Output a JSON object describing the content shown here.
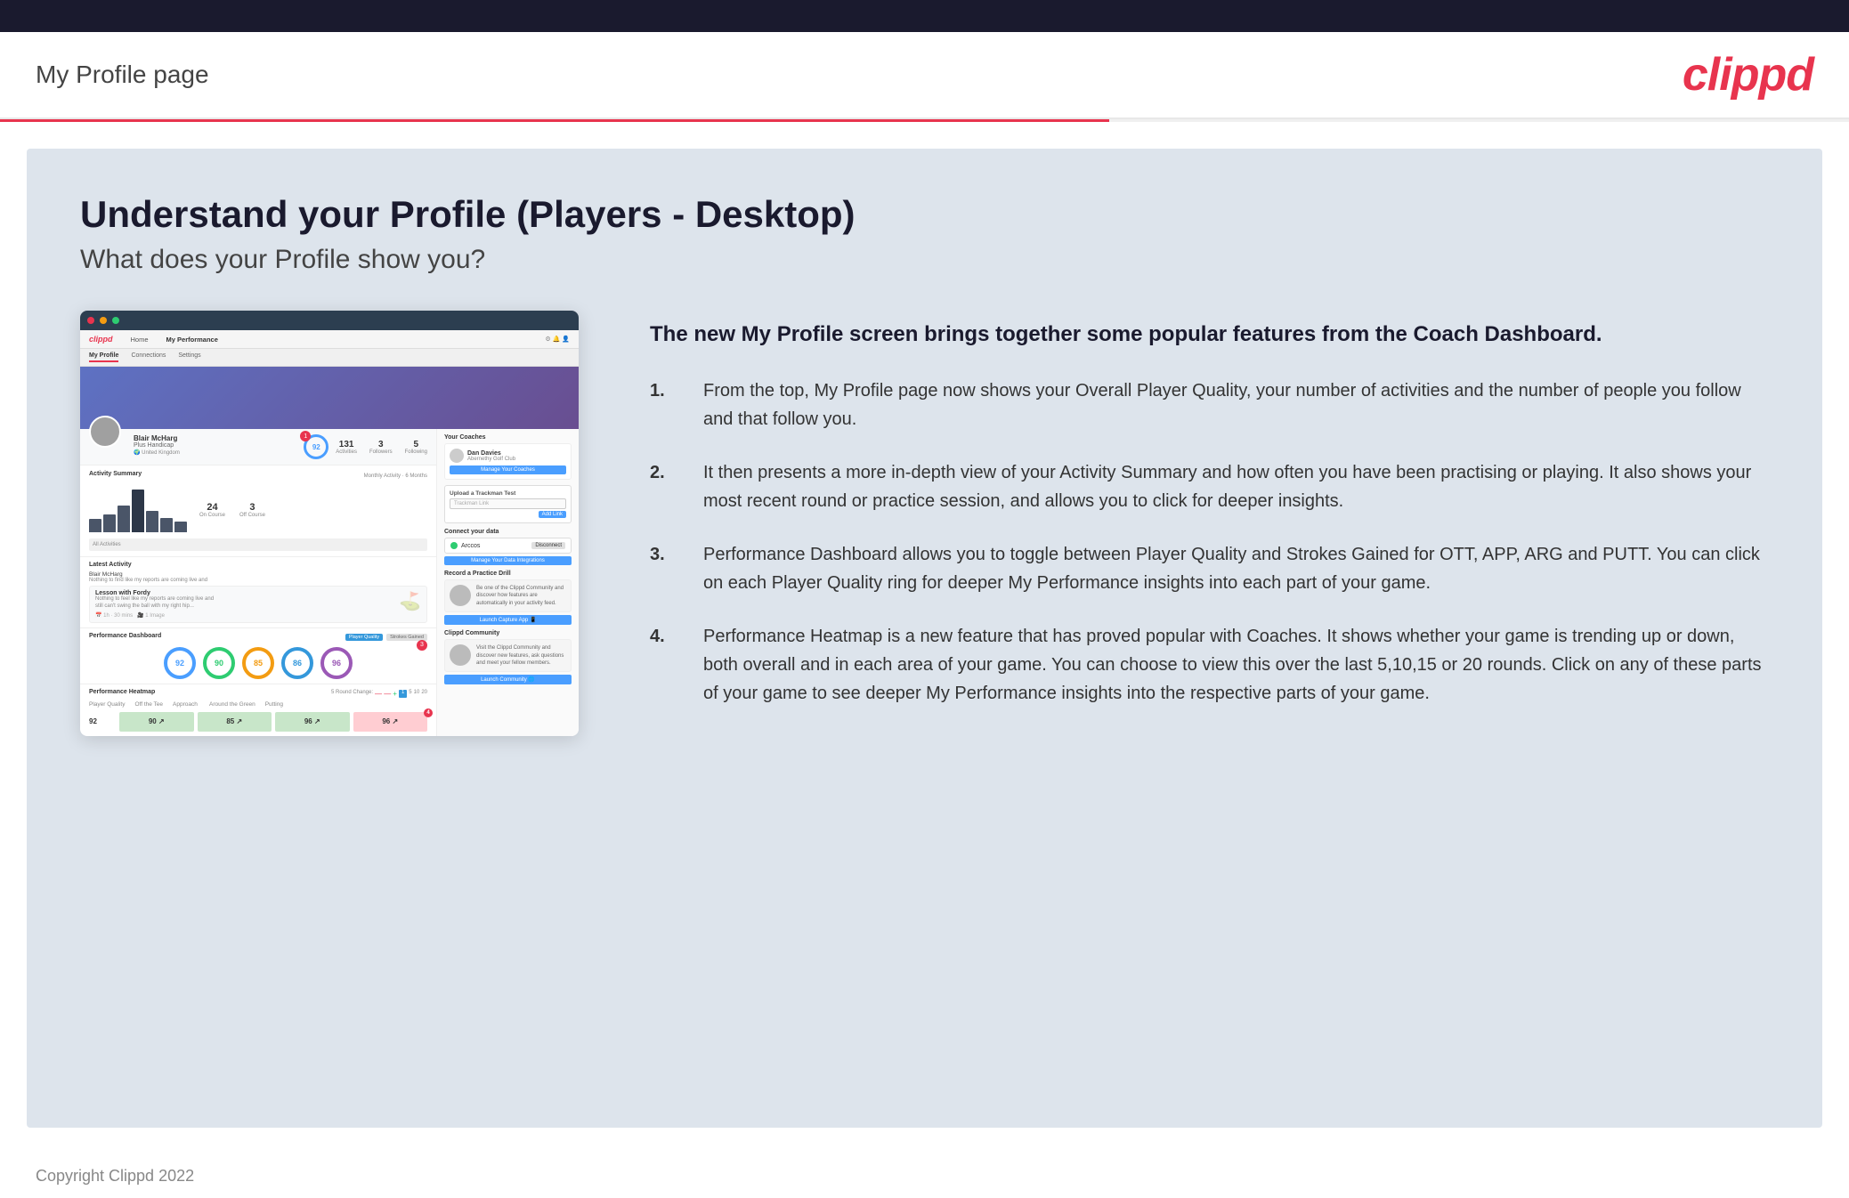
{
  "header": {
    "title": "My Profile page",
    "logo": "clippd"
  },
  "main": {
    "title": "Understand your Profile (Players - Desktop)",
    "subtitle": "What does your Profile show you?",
    "intro": "The new My Profile screen brings together some popular features from the Coach Dashboard.",
    "points": [
      "From the top, My Profile page now shows your Overall Player Quality, your number of activities and the number of people you follow and that follow you.",
      "It then presents a more in-depth view of your Activity Summary and how often you have been practising or playing. It also shows your most recent round or practice session, and allows you to click for deeper insights.",
      "Performance Dashboard allows you to toggle between Player Quality and Strokes Gained for OTT, APP, ARG and PUTT. You can click on each Player Quality ring for deeper My Performance insights into each part of your game.",
      "Performance Heatmap is a new feature that has proved popular with Coaches. It shows whether your game is trending up or down, both overall and in each area of your game. You can choose to view this over the last 5,10,15 or 20 rounds. Click on any of these parts of your game to see deeper My Performance insights into the respective parts of your game."
    ]
  },
  "mockup": {
    "nav_logo": "clippd",
    "nav_items": [
      "Home",
      "My Performance"
    ],
    "sub_nav": [
      "My Profile",
      "Connections",
      "Settings"
    ],
    "player_name": "Blair McHarg",
    "handicap": "Plus Handicap",
    "quality": "92",
    "activities": "131",
    "followers": "3",
    "following": "5",
    "on_course": "24",
    "off_course": "3",
    "section_activity": "Activity Summary",
    "section_performance": "Performance Dashboard",
    "section_heatmap": "Performance Heatmap",
    "section_latest": "Latest Activity",
    "coach_name": "Dan Davies",
    "coach_club": "Abernethy Golf Club",
    "manage_coaches": "Manage Your Coaches",
    "trackman_label": "Upload a Trackman Test",
    "trackman_placeholder": "Trackman Link",
    "connect_label": "Connect your data",
    "arccos_name": "Arccos",
    "manage_integrations": "Manage Your Data Integrations",
    "drill_label": "Record a Practice Drill",
    "community_label": "Clippd Community",
    "launch_community": "Launch Community",
    "rings": [
      {
        "value": "92",
        "color": "#4a9eff"
      },
      {
        "value": "90",
        "color": "#2ecc71"
      },
      {
        "value": "85",
        "color": "#f39c12"
      },
      {
        "value": "86",
        "color": "#3498db"
      },
      {
        "value": "96",
        "color": "#9b59b6"
      }
    ],
    "heatmap": {
      "player_quality": "92",
      "off_tee": "90",
      "approach": "85",
      "around_green": "96",
      "putting": "96"
    }
  },
  "footer": {
    "copyright": "Copyright Clippd 2022"
  }
}
